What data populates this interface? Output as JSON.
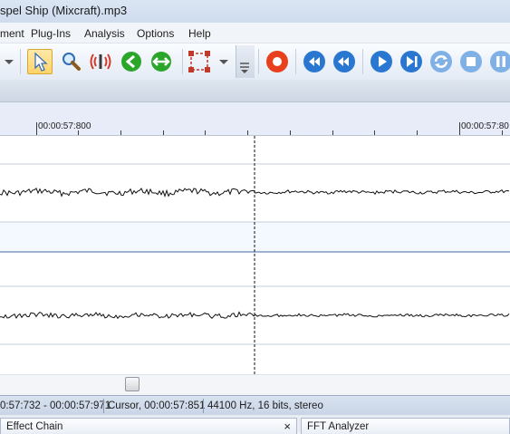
{
  "window": {
    "title": "spel Ship (Mixcraft).mp3"
  },
  "menu": {
    "items": [
      "ment",
      "Plug-Ins",
      "Analysis",
      "Options",
      "Help"
    ]
  },
  "toolbar": {
    "icons": [
      "dropdown-arrow-icon",
      "select-cursor-icon",
      "zoom-icon",
      "scrub-icon",
      "go-left-icon",
      "expand-both-icon",
      "selection-box-icon",
      "dropdown-arrow-icon",
      "toolbar-overflow-icon",
      "record-icon",
      "rewind-icon",
      "step-back-icon",
      "play-icon",
      "play-next-icon",
      "loop-icon",
      "stop-icon",
      "pause-icon"
    ]
  },
  "ruler": {
    "labels": [
      "00:00:57:800",
      "00:00:57:80"
    ]
  },
  "status": {
    "selection": "0:57:732 - 00:00:57:971",
    "cursor": "Cursor, 00:00:57:851",
    "format": "44100 Hz, 16 bits, stereo"
  },
  "panels": {
    "left_title": "Effect Chain",
    "right_title": "FFT Analyzer",
    "close_glyph": "×"
  },
  "colors": {
    "accent": "#2a77d2",
    "record": "#e8401c",
    "green": "#2aa72a"
  }
}
